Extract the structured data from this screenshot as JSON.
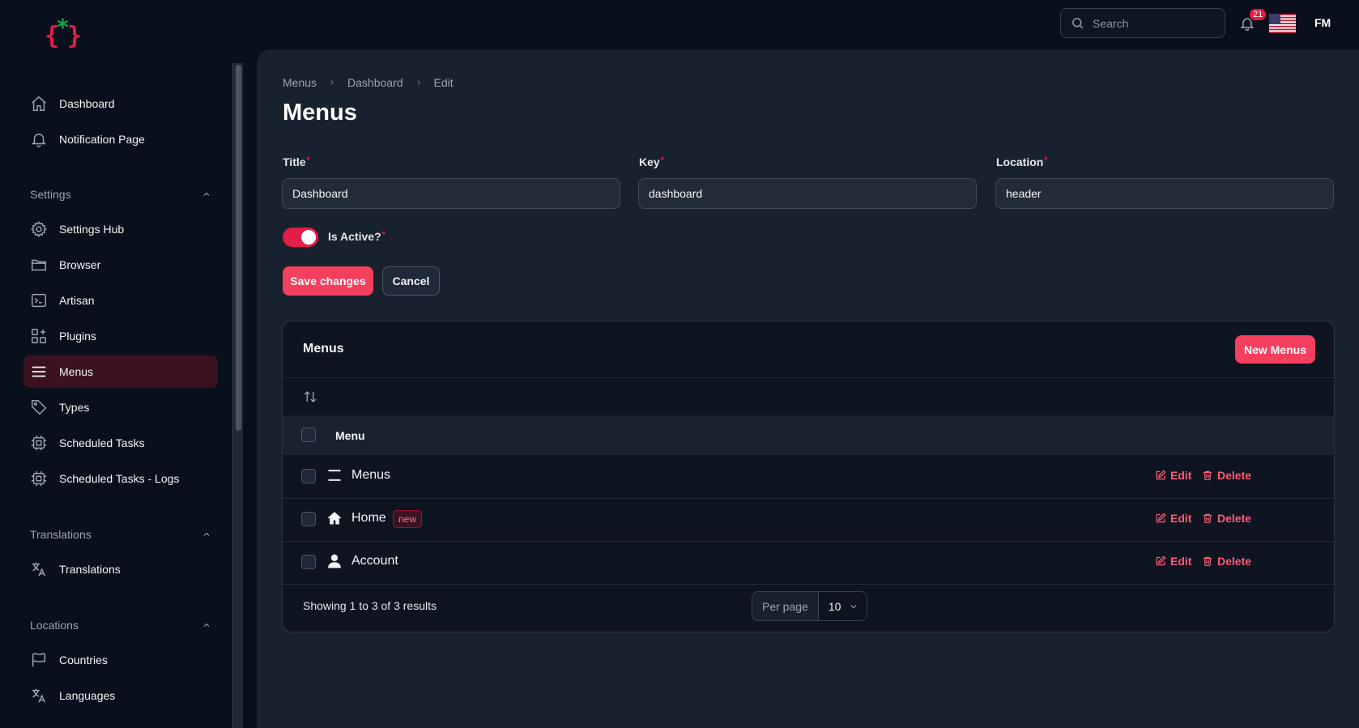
{
  "header": {
    "search_placeholder": "Search",
    "notification_count": "21",
    "user_initials": "FM"
  },
  "sidebar": {
    "top_items": [
      {
        "label": "Dashboard",
        "icon": "home-icon"
      },
      {
        "label": "Notification Page",
        "icon": "bell-icon"
      }
    ],
    "groups": [
      {
        "label": "Settings",
        "items": [
          {
            "label": "Settings Hub",
            "icon": "gear-icon"
          },
          {
            "label": "Browser",
            "icon": "folder-icon"
          },
          {
            "label": "Artisan",
            "icon": "terminal-icon"
          },
          {
            "label": "Plugins",
            "icon": "puzzle-icon"
          },
          {
            "label": "Menus",
            "icon": "menu-icon",
            "active": true
          },
          {
            "label": "Types",
            "icon": "tag-icon"
          },
          {
            "label": "Scheduled Tasks",
            "icon": "cpu-icon"
          },
          {
            "label": "Scheduled Tasks - Logs",
            "icon": "cpu-icon"
          }
        ]
      },
      {
        "label": "Translations",
        "items": [
          {
            "label": "Translations",
            "icon": "translate-icon"
          }
        ]
      },
      {
        "label": "Locations",
        "items": [
          {
            "label": "Countries",
            "icon": "flag-icon"
          },
          {
            "label": "Languages",
            "icon": "translate-icon"
          }
        ]
      }
    ]
  },
  "main": {
    "breadcrumb": [
      "Menus",
      "Dashboard",
      "Edit"
    ],
    "title": "Menus",
    "form": {
      "title_label": "Title",
      "title_value": "Dashboard",
      "key_label": "Key",
      "key_value": "dashboard",
      "location_label": "Location",
      "location_value": "header",
      "is_active_label": "Is Active?",
      "required_mark": "*",
      "save_label": "Save changes",
      "cancel_label": "Cancel"
    },
    "table": {
      "title": "Menus",
      "new_label": "New Menus",
      "column": "Menu",
      "rows": [
        {
          "label": "Menus",
          "icon": "menu-icon",
          "badge": ""
        },
        {
          "label": "Home",
          "icon": "home-solid-icon",
          "badge": "new"
        },
        {
          "label": "Account",
          "icon": "user-icon",
          "badge": ""
        }
      ],
      "edit_label": "Edit",
      "delete_label": "Delete",
      "summary": "Showing 1 to 3 of 3 results",
      "per_page_label": "Per page",
      "per_page_value": "10"
    }
  },
  "colors": {
    "accent": "#f43f5e",
    "background": "#0a0f1c",
    "panel": "#18212e"
  }
}
